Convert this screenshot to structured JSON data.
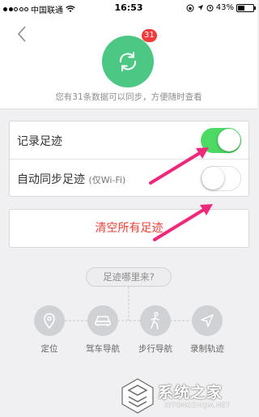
{
  "status_bar": {
    "carrier": "中国联通",
    "time": "16:53",
    "battery": "43%",
    "battery_level": 0.43
  },
  "header": {
    "badge_count": "31",
    "description": "您有31条数据可以同步，方便随时查看"
  },
  "settings": {
    "record_label": "记录足迹",
    "record_enabled": true,
    "autosync_label": "自动同步足迹",
    "autosync_sub": "(仅Wi-Fi)",
    "autosync_enabled": false
  },
  "clear_button": {
    "label": "清空所有足迹"
  },
  "where": {
    "title": "足迹哪里来?",
    "items": [
      {
        "label": "定位",
        "icon": "location-pin-icon"
      },
      {
        "label": "驾车导航",
        "icon": "car-icon"
      },
      {
        "label": "步行导航",
        "icon": "walking-person-icon"
      },
      {
        "label": "录制轨迹",
        "icon": "navigation-arrow-icon"
      }
    ]
  },
  "watermark": {
    "text": "系统之家",
    "url": "XITONGZHIJIA.NET"
  },
  "colors": {
    "green": "#4cc784",
    "toggle_on": "#4cd964",
    "badge_red": "#f23b3b",
    "clear_red": "#e8433a",
    "arrow_pink": "#f0287a"
  }
}
